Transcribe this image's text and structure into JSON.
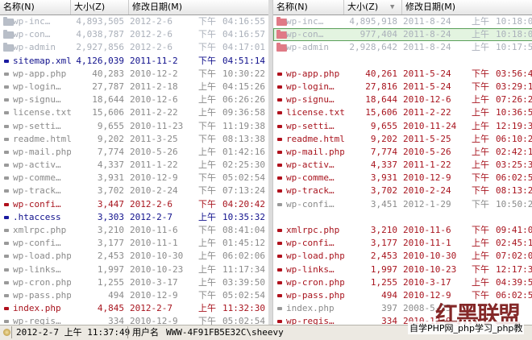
{
  "columns": {
    "name": "名称(N)",
    "size": "大小(Z)",
    "date": "修改日期(M)"
  },
  "colors": {
    "folder_gray": "#b8bec8",
    "folder_pink": "#e07a86",
    "doc_gray": "#9a9a9a",
    "doc_blue": "#1a1aa0",
    "doc_red": "#b0101c",
    "selection": "#e3f4e0"
  },
  "left": [
    {
      "name": "wp-inc…",
      "size": "4,893,505",
      "date": "2012-2-6",
      "ampm": "下午",
      "time": "04:16:55",
      "icon": "folder-icon",
      "tone": "dim"
    },
    {
      "name": "wp-con…",
      "size": "4,038,787",
      "date": "2012-2-6",
      "ampm": "下午",
      "time": "04:16:57",
      "icon": "folder-icon",
      "tone": "dim"
    },
    {
      "name": "wp-admin",
      "size": "2,927,856",
      "date": "2012-2-6",
      "ampm": "下午",
      "time": "04:17:01",
      "icon": "folder-icon",
      "tone": "dim"
    },
    {
      "name": "sitemap.xml",
      "size": "4,126,039",
      "date": "2011-11-2",
      "ampm": "下午",
      "time": "04:51:14",
      "icon": "doc-icon",
      "tone": "blue"
    },
    {
      "name": "wp-app.php",
      "size": "40,283",
      "date": "2010-12-2",
      "ampm": "下午",
      "time": "10:30:22",
      "icon": "doc-icon",
      "tone": "gray"
    },
    {
      "name": "wp-login…",
      "size": "27,787",
      "date": "2011-2-18",
      "ampm": "上午",
      "time": "04:15:26",
      "icon": "doc-icon",
      "tone": "gray"
    },
    {
      "name": "wp-signu…",
      "size": "18,644",
      "date": "2010-12-6",
      "ampm": "上午",
      "time": "06:26:26",
      "icon": "doc-icon",
      "tone": "gray"
    },
    {
      "name": "license.txt",
      "size": "15,606",
      "date": "2011-2-22",
      "ampm": "上午",
      "time": "09:36:58",
      "icon": "doc-icon",
      "tone": "gray"
    },
    {
      "name": "wp-setti…",
      "size": "9,655",
      "date": "2010-11-23",
      "ampm": "下午",
      "time": "11:19:38",
      "icon": "doc-icon",
      "tone": "gray"
    },
    {
      "name": "readme.html",
      "size": "9,202",
      "date": "2011-3-25",
      "ampm": "下午",
      "time": "08:13:38",
      "icon": "doc-icon",
      "tone": "gray"
    },
    {
      "name": "wp-mail.php",
      "size": "7,774",
      "date": "2010-5-26",
      "ampm": "上午",
      "time": "01:42:16",
      "icon": "doc-icon",
      "tone": "gray"
    },
    {
      "name": "wp-activ…",
      "size": "4,337",
      "date": "2011-1-22",
      "ampm": "上午",
      "time": "02:25:30",
      "icon": "doc-icon",
      "tone": "gray"
    },
    {
      "name": "wp-comme…",
      "size": "3,931",
      "date": "2010-12-9",
      "ampm": "下午",
      "time": "05:02:54",
      "icon": "doc-icon",
      "tone": "gray"
    },
    {
      "name": "wp-track…",
      "size": "3,702",
      "date": "2010-2-24",
      "ampm": "下午",
      "time": "07:13:24",
      "icon": "doc-icon",
      "tone": "gray"
    },
    {
      "name": "wp-confi…",
      "size": "3,447",
      "date": "2012-2-6",
      "ampm": "下午",
      "time": "04:20:42",
      "icon": "doc-icon",
      "tone": "red"
    },
    {
      "name": ".htaccess",
      "size": "3,303",
      "date": "2012-2-7",
      "ampm": "上午",
      "time": "10:35:32",
      "icon": "doc-icon",
      "tone": "blue"
    },
    {
      "name": "xmlrpc.php",
      "size": "3,210",
      "date": "2010-11-6",
      "ampm": "下午",
      "time": "08:41:04",
      "icon": "doc-icon",
      "tone": "gray"
    },
    {
      "name": "wp-confi…",
      "size": "3,177",
      "date": "2010-11-1",
      "ampm": "上午",
      "time": "01:45:12",
      "icon": "doc-icon",
      "tone": "gray"
    },
    {
      "name": "wp-load.php",
      "size": "2,453",
      "date": "2010-10-30",
      "ampm": "上午",
      "time": "06:02:06",
      "icon": "doc-icon",
      "tone": "gray"
    },
    {
      "name": "wp-links…",
      "size": "1,997",
      "date": "2010-10-23",
      "ampm": "上午",
      "time": "11:17:34",
      "icon": "doc-icon",
      "tone": "gray"
    },
    {
      "name": "wp-cron.php",
      "size": "1,255",
      "date": "2010-3-17",
      "ampm": "上午",
      "time": "03:39:50",
      "icon": "doc-icon",
      "tone": "gray"
    },
    {
      "name": "wp-pass.php",
      "size": "494",
      "date": "2010-12-9",
      "ampm": "下午",
      "time": "05:02:54",
      "icon": "doc-icon",
      "tone": "gray"
    },
    {
      "name": "index.php",
      "size": "4,845",
      "date": "2012-2-7",
      "ampm": "上午",
      "time": "11:32:30",
      "icon": "doc-icon",
      "tone": "red"
    },
    {
      "name": "wp-regis…",
      "size": "334",
      "date": "2010-12-9",
      "ampm": "下午",
      "time": "05:02:54",
      "icon": "doc-icon",
      "tone": "gray"
    }
  ],
  "right": [
    {
      "name": "wp-inc…",
      "size": "4,895,918",
      "date": "2011-8-24",
      "ampm": "上午",
      "time": "10:18:09",
      "icon": "folder-icon",
      "tone": "dim"
    },
    {
      "name": "wp-con…",
      "size": "977,404",
      "date": "2011-8-24",
      "ampm": "上午",
      "time": "10:18:00",
      "icon": "folder-icon",
      "tone": "dim",
      "selected": true
    },
    {
      "name": "wp-admin",
      "size": "2,928,642",
      "date": "2011-8-24",
      "ampm": "上午",
      "time": "10:17:58",
      "icon": "folder-icon",
      "tone": "dim"
    },
    {
      "name": "",
      "size": "",
      "date": "",
      "ampm": "",
      "time": "",
      "icon": "",
      "tone": "gray"
    },
    {
      "name": "wp-app.php",
      "size": "40,261",
      "date": "2011-5-24",
      "ampm": "下午",
      "time": "03:56:40",
      "icon": "doc-icon",
      "tone": "red"
    },
    {
      "name": "wp-login…",
      "size": "27,816",
      "date": "2011-5-24",
      "ampm": "下午",
      "time": "03:29:12",
      "icon": "doc-icon",
      "tone": "red"
    },
    {
      "name": "wp-signu…",
      "size": "18,644",
      "date": "2010-12-6",
      "ampm": "上午",
      "time": "07:26:26",
      "icon": "doc-icon",
      "tone": "red"
    },
    {
      "name": "license.txt",
      "size": "15,606",
      "date": "2011-2-22",
      "ampm": "上午",
      "time": "10:36:58",
      "icon": "doc-icon",
      "tone": "red"
    },
    {
      "name": "wp-setti…",
      "size": "9,655",
      "date": "2010-11-24",
      "ampm": "上午",
      "time": "12:19:38",
      "icon": "doc-icon",
      "tone": "red"
    },
    {
      "name": "readme.html",
      "size": "9,202",
      "date": "2011-5-25",
      "ampm": "上午",
      "time": "06:10:20",
      "icon": "doc-icon",
      "tone": "red"
    },
    {
      "name": "wp-mail.php",
      "size": "7,774",
      "date": "2010-5-26",
      "ampm": "上午",
      "time": "02:42:16",
      "icon": "doc-icon",
      "tone": "red"
    },
    {
      "name": "wp-activ…",
      "size": "4,337",
      "date": "2011-1-22",
      "ampm": "上午",
      "time": "03:25:30",
      "icon": "doc-icon",
      "tone": "red"
    },
    {
      "name": "wp-comme…",
      "size": "3,931",
      "date": "2010-12-9",
      "ampm": "下午",
      "time": "06:02:54",
      "icon": "doc-icon",
      "tone": "red"
    },
    {
      "name": "wp-track…",
      "size": "3,702",
      "date": "2010-2-24",
      "ampm": "下午",
      "time": "08:13:24",
      "icon": "doc-icon",
      "tone": "red"
    },
    {
      "name": "wp-confi…",
      "size": "3,451",
      "date": "2012-1-29",
      "ampm": "下午",
      "time": "10:50:24",
      "icon": "doc-icon",
      "tone": "gray"
    },
    {
      "name": "",
      "size": "",
      "date": "",
      "ampm": "",
      "time": "",
      "icon": "",
      "tone": "gray"
    },
    {
      "name": "xmlrpc.php",
      "size": "3,210",
      "date": "2010-11-6",
      "ampm": "下午",
      "time": "09:41:04",
      "icon": "doc-icon",
      "tone": "red"
    },
    {
      "name": "wp-confi…",
      "size": "3,177",
      "date": "2010-11-1",
      "ampm": "上午",
      "time": "02:45:12",
      "icon": "doc-icon",
      "tone": "red"
    },
    {
      "name": "wp-load.php",
      "size": "2,453",
      "date": "2010-10-30",
      "ampm": "上午",
      "time": "07:02:06",
      "icon": "doc-icon",
      "tone": "red"
    },
    {
      "name": "wp-links…",
      "size": "1,997",
      "date": "2010-10-23",
      "ampm": "下午",
      "time": "12:17:34",
      "icon": "doc-icon",
      "tone": "red"
    },
    {
      "name": "wp-cron.php",
      "size": "1,255",
      "date": "2010-3-17",
      "ampm": "上午",
      "time": "04:39:50",
      "icon": "doc-icon",
      "tone": "red"
    },
    {
      "name": "wp-pass.php",
      "size": "494",
      "date": "2010-12-9",
      "ampm": "下午",
      "time": "06:02:54",
      "icon": "doc-icon",
      "tone": "red"
    },
    {
      "name": "index.php",
      "size": "397",
      "date": "2008-5-25",
      "ampm": "",
      "time": "",
      "icon": "doc-icon",
      "tone": "gray"
    },
    {
      "name": "wp-regis…",
      "size": "334",
      "date": "2010-12-9",
      "ampm": "",
      "time": "",
      "icon": "doc-icon",
      "tone": "red"
    }
  ],
  "status": {
    "datetime": "2012-2-7 上午 11:37:49",
    "user_label": "用户名",
    "user": "WWW-4F91FB5E32C\\sheevy"
  },
  "watermark": {
    "logo": "红黑联盟",
    "text": "自学PHP网_php学习_php教"
  }
}
